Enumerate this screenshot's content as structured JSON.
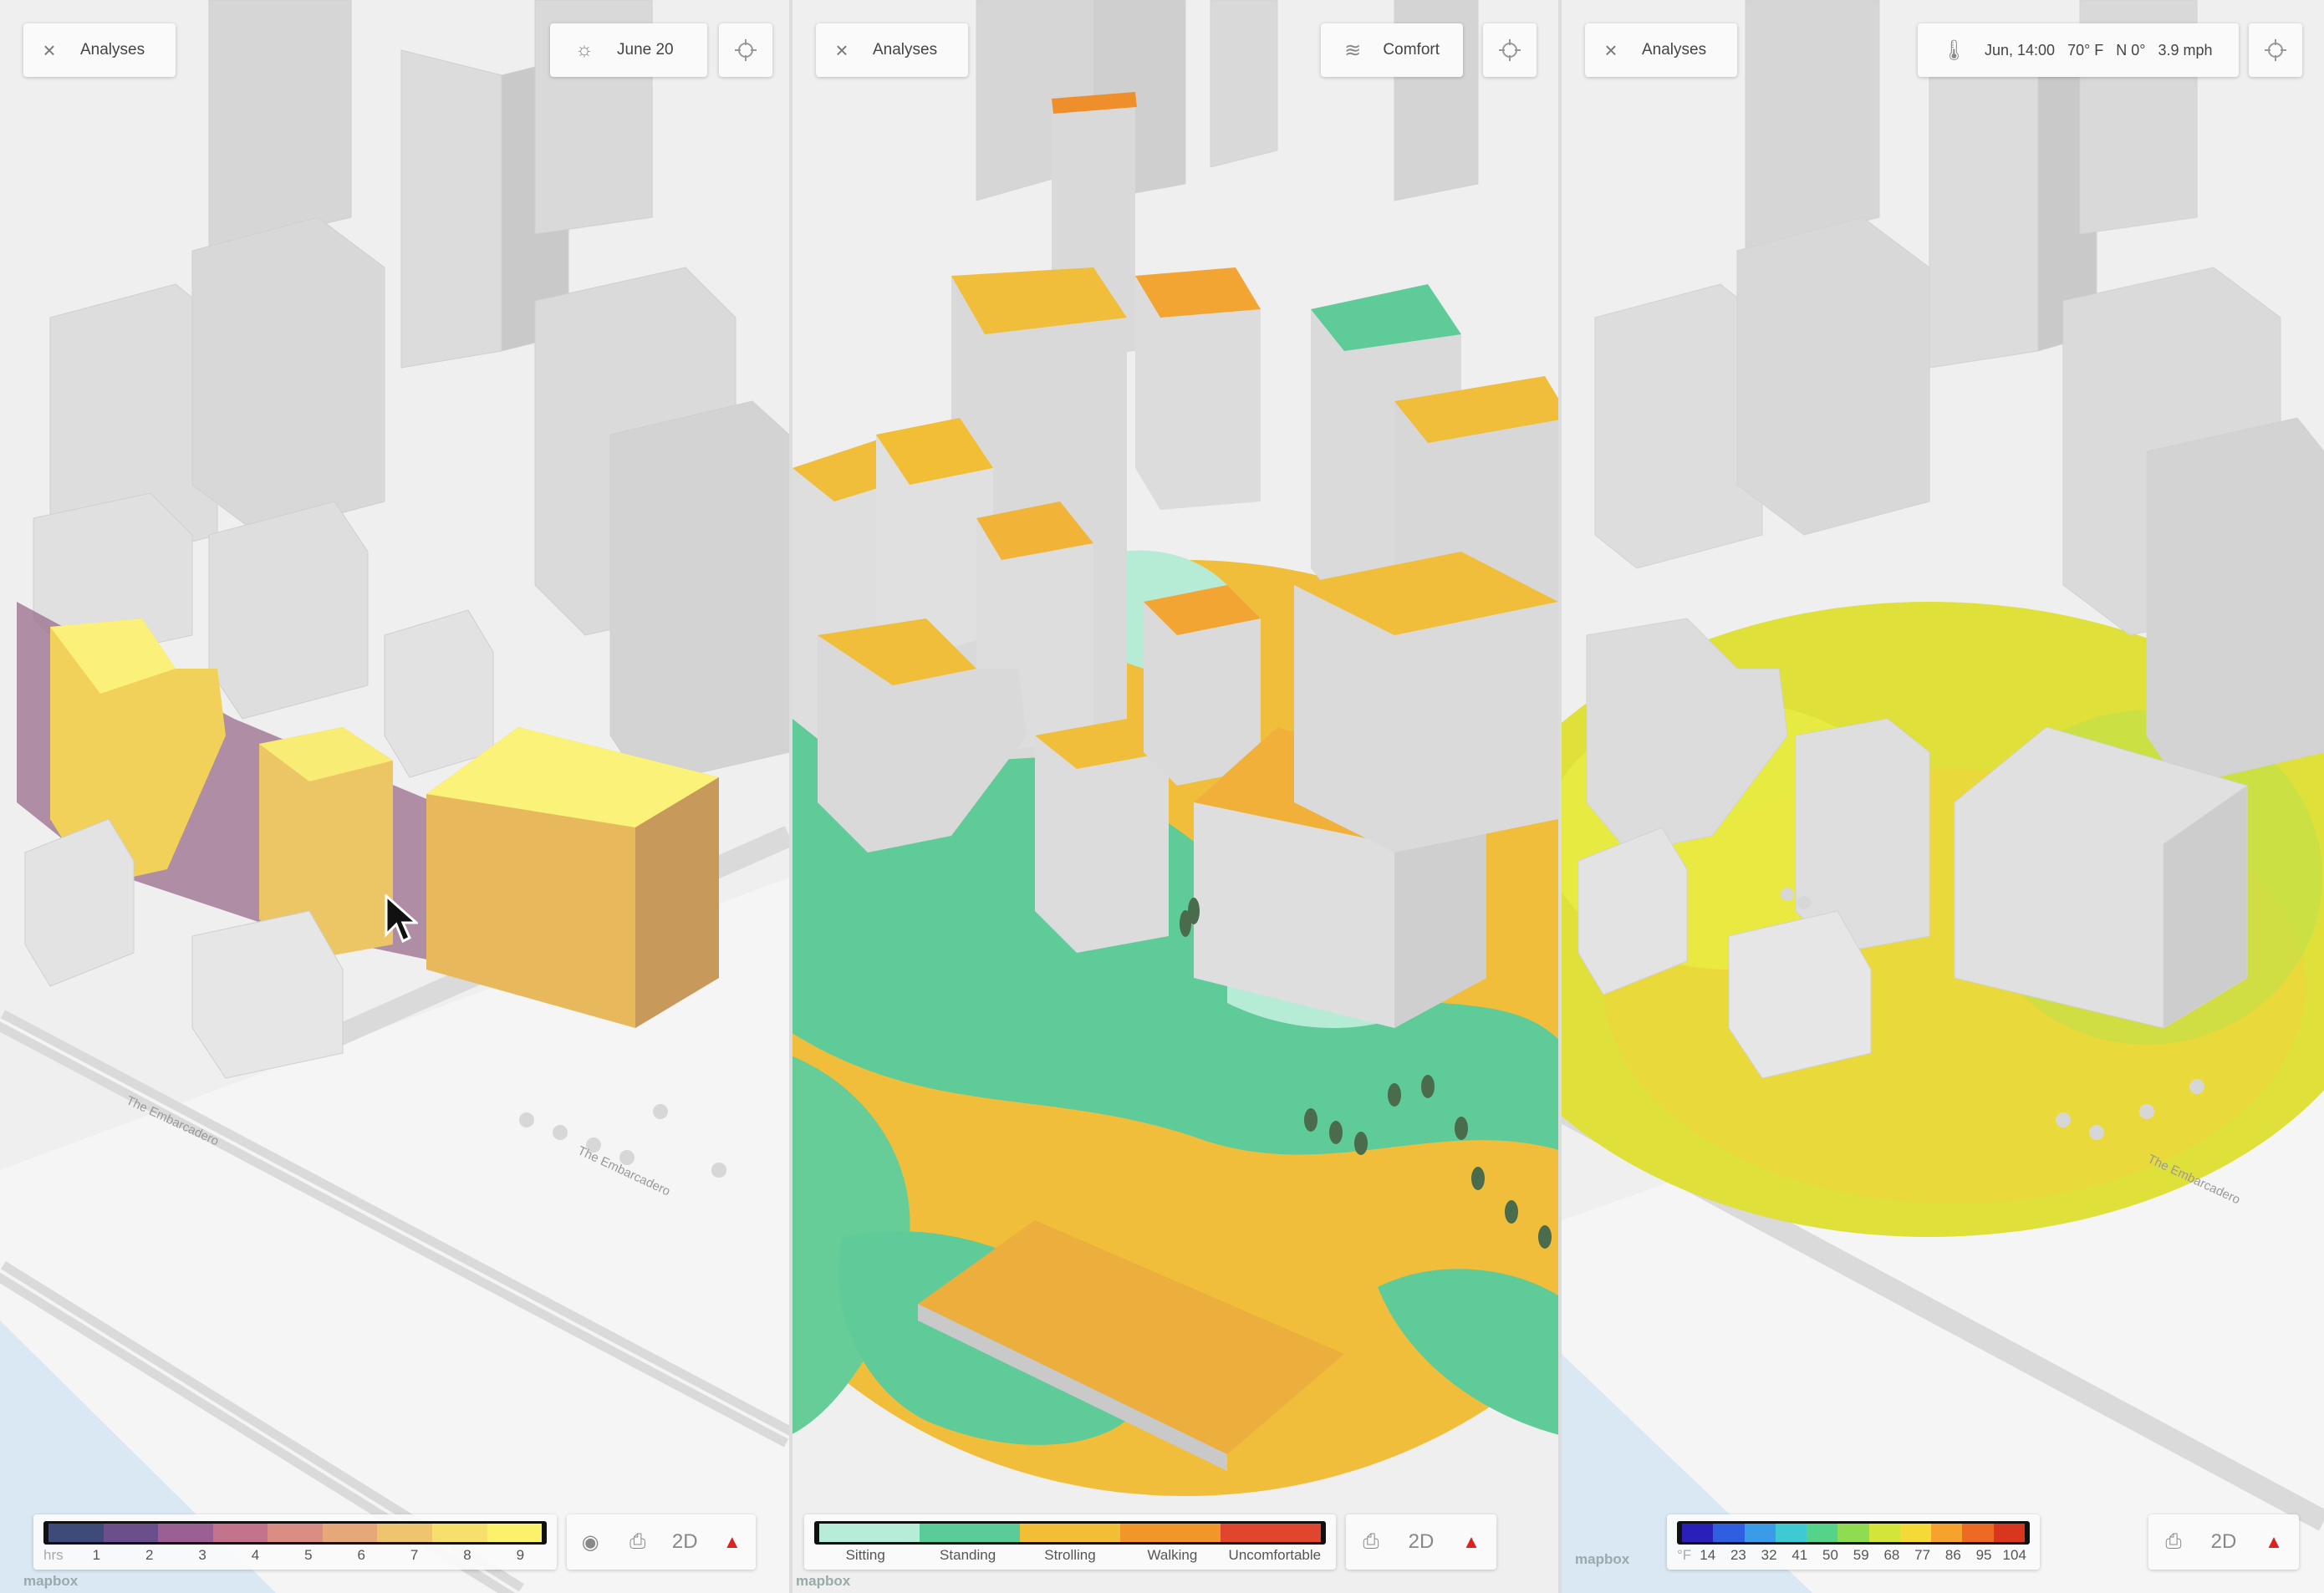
{
  "panels": [
    {
      "analyses_label": "Analyses",
      "info": {
        "icon": "sun-icon",
        "text": "June 20"
      },
      "legend": {
        "type": "sun-hours",
        "unit": "hrs",
        "ticks": [
          "1",
          "2",
          "3",
          "4",
          "5",
          "6",
          "7",
          "8",
          "9"
        ],
        "colors": [
          "#3d4a7a",
          "#6b4f8c",
          "#9c5f93",
          "#c3738c",
          "#d98d83",
          "#e6a878",
          "#efc46f",
          "#f6df6a",
          "#fbf16b"
        ]
      },
      "controls": [
        "eye-icon",
        "camera-icon",
        "2D",
        "compass-icon"
      ],
      "attribution": "mapbox"
    },
    {
      "analyses_label": "Analyses",
      "info": {
        "icon": "wind-icon",
        "text": "Comfort"
      },
      "legend": {
        "type": "comfort",
        "ticks": [
          "Sitting",
          "Standing",
          "Strolling",
          "Walking",
          "Uncomfortable"
        ],
        "colors": [
          "#b7ecd8",
          "#5ccb9a",
          "#f2be35",
          "#f2962a",
          "#e0452e"
        ]
      },
      "controls": [
        "camera-icon",
        "2D",
        "compass-icon"
      ],
      "attribution": "mapbox"
    },
    {
      "analyses_label": "Analyses",
      "info": {
        "icon": "thermometer-icon",
        "text": "Jun, 14:00   70° F   N 0°   3.9 mph"
      },
      "legend": {
        "type": "temperature",
        "unit": "°F",
        "ticks": [
          "14",
          "23",
          "32",
          "41",
          "50",
          "59",
          "68",
          "77",
          "86",
          "95",
          "104"
        ],
        "colors": [
          "#2a1fb8",
          "#2f5fe0",
          "#3a9be8",
          "#3fc9d2",
          "#55d38a",
          "#8fdc52",
          "#d3e43a",
          "#f5d936",
          "#f5a32c",
          "#ec6a24",
          "#d8361e"
        ]
      },
      "controls": [
        "camera-icon",
        "2D",
        "compass-icon"
      ],
      "attribution": "mapbox"
    }
  ]
}
